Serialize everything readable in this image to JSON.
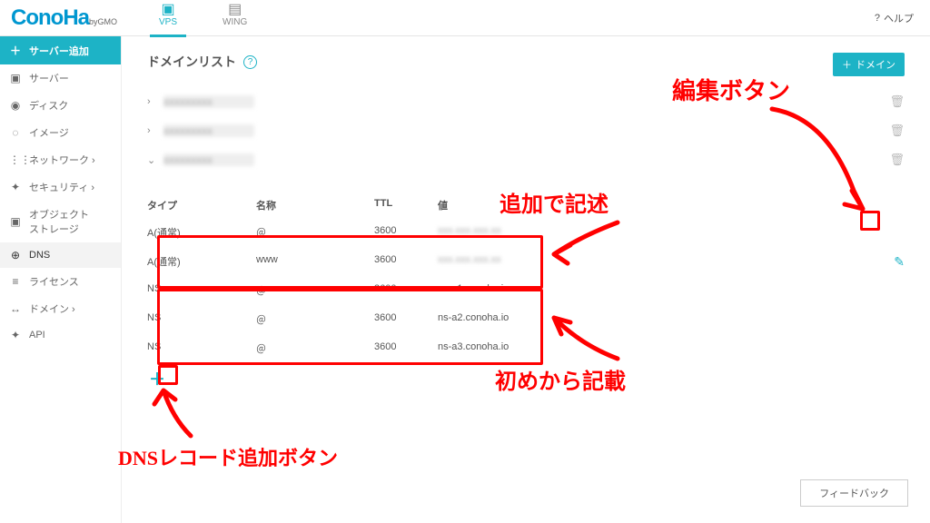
{
  "header": {
    "logo_main": "ConoHa",
    "logo_sub": "byGMO",
    "tabs": [
      {
        "label": "VPS",
        "active": true
      },
      {
        "label": "WING",
        "active": false
      }
    ],
    "help": "ヘルプ"
  },
  "sidebar": {
    "items": [
      {
        "icon": "＋",
        "label": "サーバー追加",
        "class": "add"
      },
      {
        "icon": "▣",
        "label": "サーバー"
      },
      {
        "icon": "◉",
        "label": "ディスク"
      },
      {
        "icon": "◌",
        "label": "イメージ"
      },
      {
        "icon": "⋮⋮",
        "label": "ネットワーク ›"
      },
      {
        "icon": "✦",
        "label": "セキュリティ ›"
      },
      {
        "icon": "▣",
        "label": "オブジェクト\nストレージ"
      },
      {
        "icon": "⊕",
        "label": "DNS",
        "class": "active"
      },
      {
        "icon": "≡",
        "label": "ライセンス"
      },
      {
        "icon": "↔",
        "label": "ドメイン ›"
      },
      {
        "icon": "✦",
        "label": "API"
      }
    ]
  },
  "main": {
    "title": "ドメインリスト",
    "add_domain_btn": "ドメイン",
    "domains": [
      {
        "chev": "›",
        "hidden": true
      },
      {
        "chev": "›",
        "hidden": true
      },
      {
        "chev": "⌄",
        "hidden": true
      }
    ],
    "record_headers": {
      "type": "タイプ",
      "name": "名称",
      "ttl": "TTL",
      "val": "値"
    },
    "records": [
      {
        "type": "A(通常)",
        "name": "＠",
        "ttl": "3600",
        "val": "xxx.xxx.xxx.xx",
        "blur": true
      },
      {
        "type": "A(通常)",
        "name": "www",
        "ttl": "3600",
        "val": "xxx.xxx.xxx.xx",
        "blur": true
      },
      {
        "type": "NS",
        "name": "＠",
        "ttl": "3600",
        "val": "ns-a1.conoha.io"
      },
      {
        "type": "NS",
        "name": "＠",
        "ttl": "3600",
        "val": "ns-a2.conoha.io"
      },
      {
        "type": "NS",
        "name": "＠",
        "ttl": "3600",
        "val": "ns-a3.conoha.io"
      }
    ],
    "feedback": "フィードバック"
  },
  "annotations": {
    "edit_btn": "編集ボタン",
    "added": "追加で記述",
    "default": "初めから記載",
    "add_record": "DNSレコード追加ボタン"
  }
}
